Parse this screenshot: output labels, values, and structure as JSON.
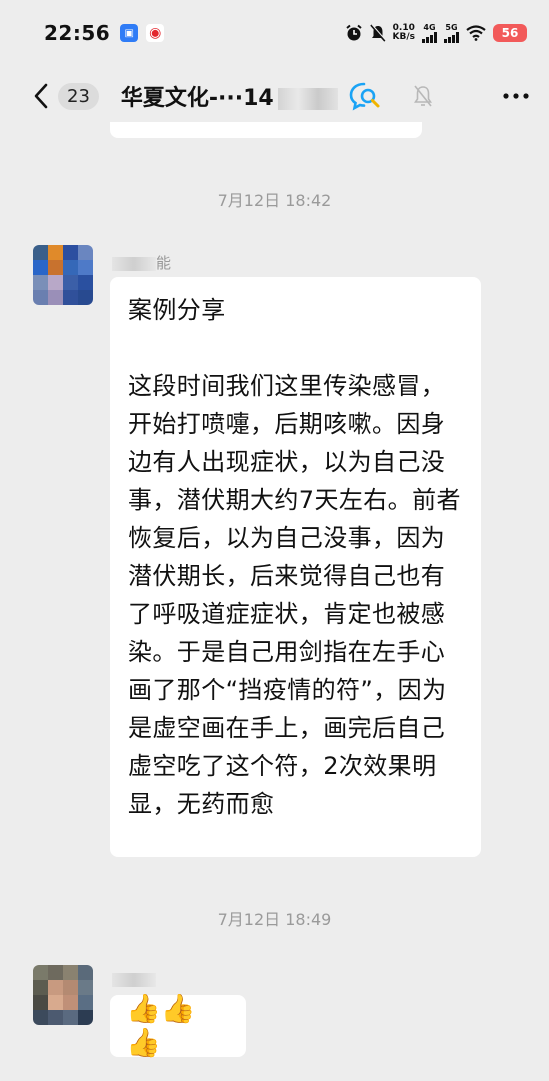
{
  "status_bar": {
    "time": "22:56",
    "net_speed_value": "0.10",
    "net_speed_unit": "KB/s",
    "signal_1_label": "4G",
    "signal_2_label": "5G",
    "battery": "56"
  },
  "header": {
    "unread_count": "23",
    "title": "华夏文化-···14"
  },
  "messages": [
    {
      "timestamp": "7月12日 18:42",
      "sender_visible": "能",
      "title": "案例分享",
      "body": "这段时间我们这里传染感冒，开始打喷嚏，后期咳嗽。因身边有人出现症状，以为自己没事，潜伏期大约7天左右。前者恢复后，以为自己没事，因为潜伏期长，后来觉得自己也有了呼吸道症症状，肯定也被感染。于是自己用剑指在左手心画了那个“挡疫情的符”，因为是虚空画在手上，画完后自己虚空吃了这个符，2次效果明显，无药而愈"
    },
    {
      "timestamp": "7月12日 18:49",
      "emoji": "👍👍👍"
    }
  ],
  "colors": {
    "background": "#ededed",
    "bubble": "#ffffff",
    "timestamp": "#9a9a9a",
    "battery": "#f25a5a",
    "accent_blue": "#1aa3f5"
  },
  "icons": [
    "back-chevron-icon",
    "chat-search-icon",
    "mute-bell-icon",
    "more-icon",
    "alarm-icon",
    "silent-icon",
    "wifi-icon"
  ]
}
